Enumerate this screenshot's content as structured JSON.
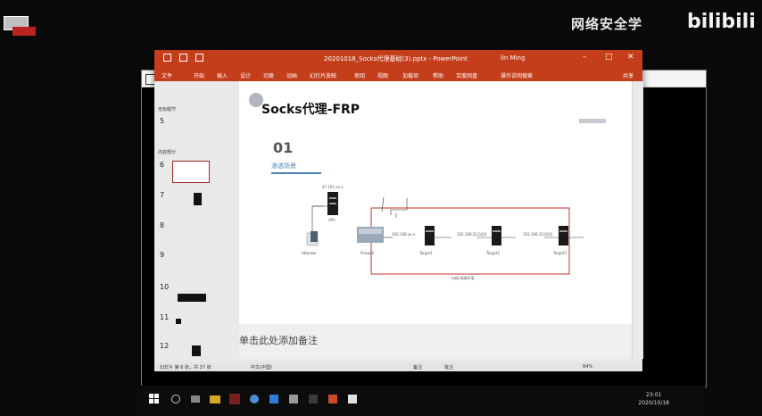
{
  "watermark": {
    "text": "网络安全学",
    "brand": "bilibili"
  },
  "window": {
    "title": "20201018_Socks代理基础(3).pptx - PowerPoint",
    "user": "lin Ming",
    "minimize": "–",
    "maximize": "□",
    "close": "✕"
  },
  "ribbon": {
    "tabs": [
      "文件",
      "开始",
      "插入",
      "设计",
      "切换",
      "动画",
      "幻灯片放映",
      "审阅",
      "视图",
      "加载项",
      "帮助",
      "百度网盘",
      "操作说明搜索"
    ],
    "share": "共享"
  },
  "slide_panel": {
    "section1": "无标题节",
    "section2": "内容部分",
    "numbers": [
      "5",
      "6",
      "7",
      "8",
      "9",
      "10",
      "11",
      "12"
    ],
    "selected": "6"
  },
  "slide": {
    "title": "Socks代理-FRP",
    "number": "01",
    "subtitle": "渗透场景",
    "diagram": {
      "vps_label": "47.101.xx.x",
      "vps_name": "VPS",
      "attacker": "Attacker",
      "firewall": "Firewall",
      "target1": "Target1",
      "target2": "Target2",
      "target3": "Target3",
      "link1": "192.168.xx.x",
      "link2": "192.168.22.0/24",
      "link3": "192.168.33.0/24",
      "intranet": "内网 网络环境"
    }
  },
  "notes": {
    "placeholder": "单击此处添加备注"
  },
  "statusbar": {
    "slide_info": "幻灯片 第 6 张，共 37 张",
    "language": "中文(中国)",
    "notes": "备注",
    "comments": "批注",
    "zoom": "64%"
  },
  "taskbar": {
    "time": "23:01",
    "date": "2020/10/18"
  },
  "colors": {
    "ppt_red": "#c43e1c",
    "accent_blue": "#4a82b8",
    "intranet_border": "#c0312b"
  }
}
